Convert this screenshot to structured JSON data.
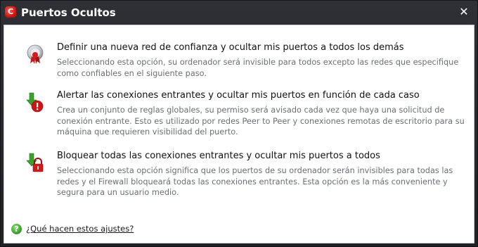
{
  "window": {
    "title": "Puertos Ocultos",
    "app_logo_letter": "C",
    "close_symbol": "✕"
  },
  "options": [
    {
      "icon": "shield-ribbon-icon",
      "title": "Definir una nueva red de confianza y ocultar mis puertos a todos los demás",
      "description": "Seleccionando esta opción, su ordenador será invisible para todos excepto las redes que especifique como confiables en el siguiente paso."
    },
    {
      "icon": "alert-arrow-icon",
      "title": "Alertar las conexiones entrantes y ocultar mis puertos en función de cada caso",
      "description": "Crea un conjunto de reglas globales, su permiso será avisado cada vez que haya una solicitud de conexión entrante. Esto es utilizado por redes Peer to Peer y conexiones remotas de escritorio para su máquina que requieren visibilidad del puerto."
    },
    {
      "icon": "lock-arrow-icon",
      "title": "Bloquear todas las conexiones entrantes y ocultar mis puertos a todos",
      "description": "Seleccionando esta opción significa que los puertos de su ordenador serán invisibles para todas las redes y el Firewall bloqueará todas las conexiones entrantes. Esta opción es la más conveniente y segura para un usuario medio."
    }
  ],
  "help": {
    "icon": "help-icon",
    "icon_glyph": "?",
    "link_label": "¿Qué hacen estos ajustes?"
  },
  "colors": {
    "titlebar": "#2a2c30",
    "title_text": "#ffffff",
    "body_bg": "#ffffff",
    "option_title": "#111111",
    "option_desc": "#6b6f75",
    "logo_red": "#d01010",
    "help_green": "#3a9a2a"
  }
}
